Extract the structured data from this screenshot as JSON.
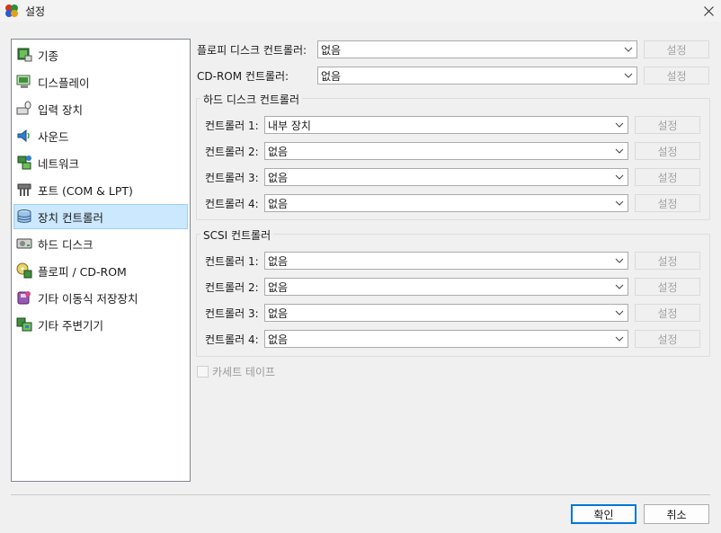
{
  "window": {
    "title": "설정"
  },
  "sidebar": {
    "items": [
      {
        "label": "기종",
        "icon": "machine-icon"
      },
      {
        "label": "디스플레이",
        "icon": "display-icon"
      },
      {
        "label": "입력 장치",
        "icon": "input-devices-icon"
      },
      {
        "label": "사운드",
        "icon": "sound-icon"
      },
      {
        "label": "네트워크",
        "icon": "network-icon"
      },
      {
        "label": "포트 (COM & LPT)",
        "icon": "ports-icon"
      },
      {
        "label": "장치 컨트롤러",
        "icon": "storage-controllers-icon",
        "selected": true
      },
      {
        "label": "하드 디스크",
        "icon": "hard-disk-icon"
      },
      {
        "label": "플로피 / CD-ROM",
        "icon": "floppy-cdrom-icon"
      },
      {
        "label": "기타 이동식 저장장치",
        "icon": "removable-storage-icon"
      },
      {
        "label": "기타 주변기기",
        "icon": "peripherals-icon"
      }
    ]
  },
  "main": {
    "floppy_controller": {
      "label": "플로피 디스크 컨트롤러:",
      "value": "없음",
      "button": "설정"
    },
    "cdrom_controller": {
      "label": "CD-ROM 컨트롤러:",
      "value": "없음",
      "button": "설정"
    },
    "hdd_group": {
      "title": "하드 디스크 컨트롤러",
      "rows": [
        {
          "label": "컨트롤러 1:",
          "value": "내부 장치",
          "button": "설정"
        },
        {
          "label": "컨트롤러 2:",
          "value": "없음",
          "button": "설정"
        },
        {
          "label": "컨트롤러 3:",
          "value": "없음",
          "button": "설정"
        },
        {
          "label": "컨트롤러 4:",
          "value": "없음",
          "button": "설정"
        }
      ]
    },
    "scsi_group": {
      "title": "SCSI 컨트롤러",
      "rows": [
        {
          "label": "컨트롤러 1:",
          "value": "없음",
          "button": "설정"
        },
        {
          "label": "컨트롤러 2:",
          "value": "없음",
          "button": "설정"
        },
        {
          "label": "컨트롤러 3:",
          "value": "없음",
          "button": "설정"
        },
        {
          "label": "컨트롤러 4:",
          "value": "없음",
          "button": "설정"
        }
      ]
    },
    "cassette": {
      "label": "카세트 테이프",
      "checked": false,
      "enabled": false
    }
  },
  "footer": {
    "ok_label": "확인",
    "cancel_label": "취소"
  },
  "colors": {
    "selection_bg": "#cce8ff",
    "selection_border": "#99d1ff",
    "default_button_border": "#0078d7"
  }
}
